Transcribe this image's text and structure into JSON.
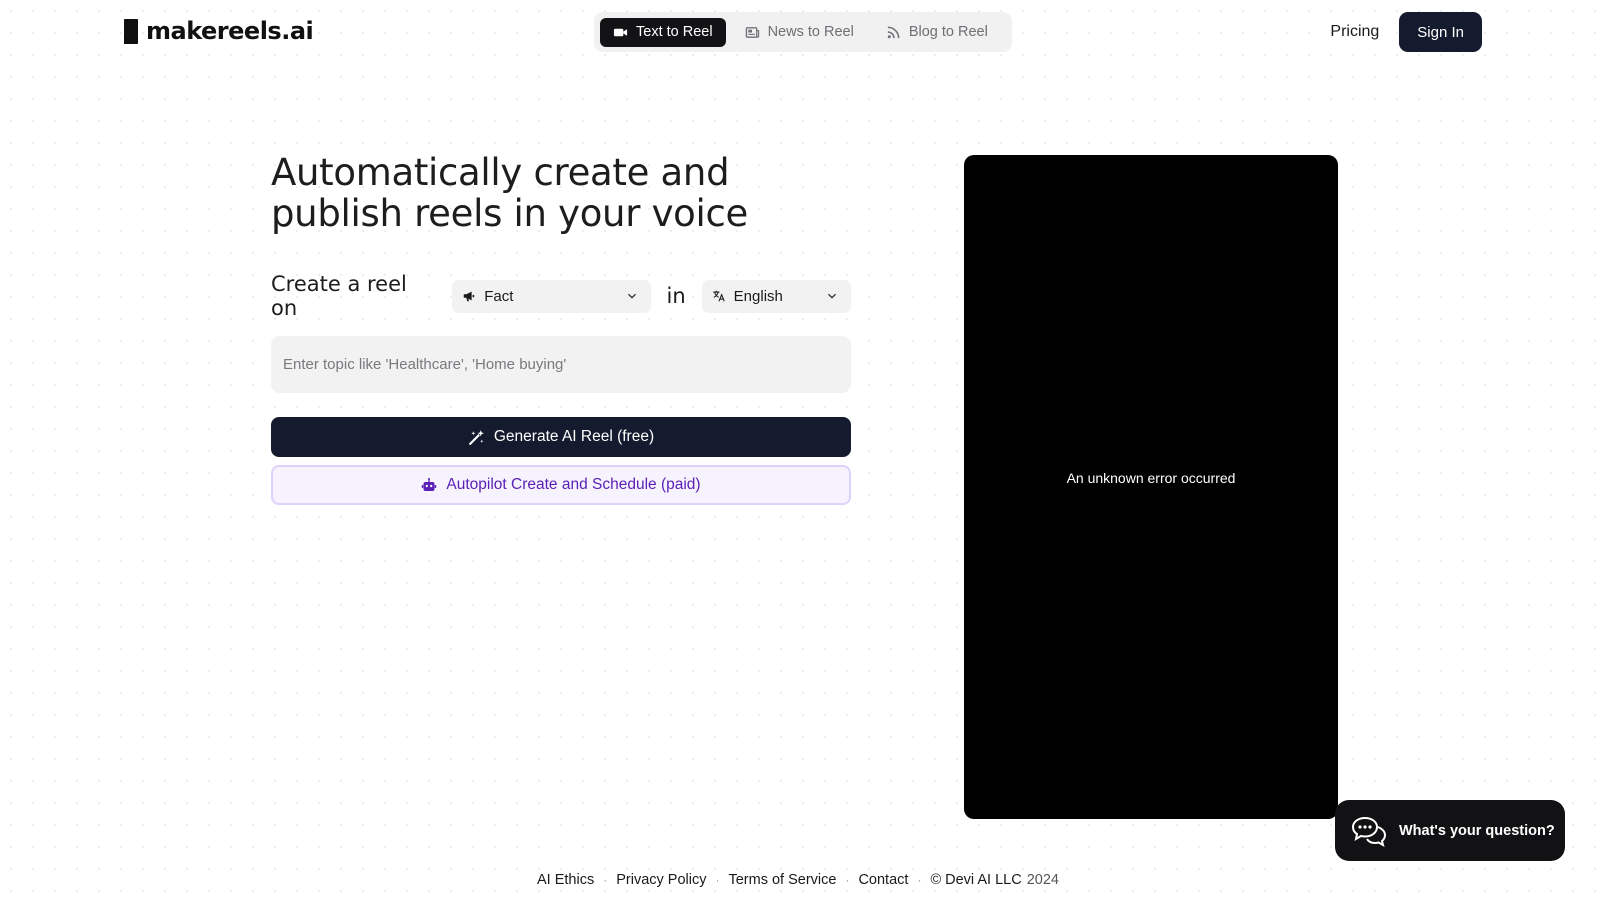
{
  "header": {
    "logo_text": "makereels.ai",
    "tabs": [
      {
        "label": "Text to Reel",
        "icon": "video-camera-icon",
        "active": true
      },
      {
        "label": "News to Reel",
        "icon": "newspaper-icon",
        "active": false
      },
      {
        "label": "Blog to Reel",
        "icon": "rss-icon",
        "active": false
      }
    ],
    "pricing_label": "Pricing",
    "signin_label": "Sign In"
  },
  "main": {
    "headline": "Automatically create and publish reels in your voice",
    "create_label": "Create a reel on",
    "type_select": {
      "value": "Fact",
      "icon": "megaphone-icon"
    },
    "in_label": "in",
    "language_select": {
      "value": "English",
      "icon": "translate-icon"
    },
    "topic_input": {
      "value": "",
      "placeholder": "Enter topic like 'Healthcare', 'Home buying'"
    },
    "generate_label": "Generate AI Reel (free)",
    "autopilot_label": "Autopilot Create and Schedule (paid)"
  },
  "preview": {
    "message": "An unknown error occurred"
  },
  "chat": {
    "label": "What's your question?"
  },
  "footer": {
    "links": [
      "AI Ethics",
      "Privacy Policy",
      "Terms of Service",
      "Contact"
    ],
    "copyright": "© Devi AI LLC",
    "year": "2024"
  },
  "colors": {
    "primary_dark": "#151b2e",
    "autopilot_text": "#5b21b6",
    "autopilot_border": "#ddd2fb",
    "autopilot_bg": "#f6f3ff"
  }
}
